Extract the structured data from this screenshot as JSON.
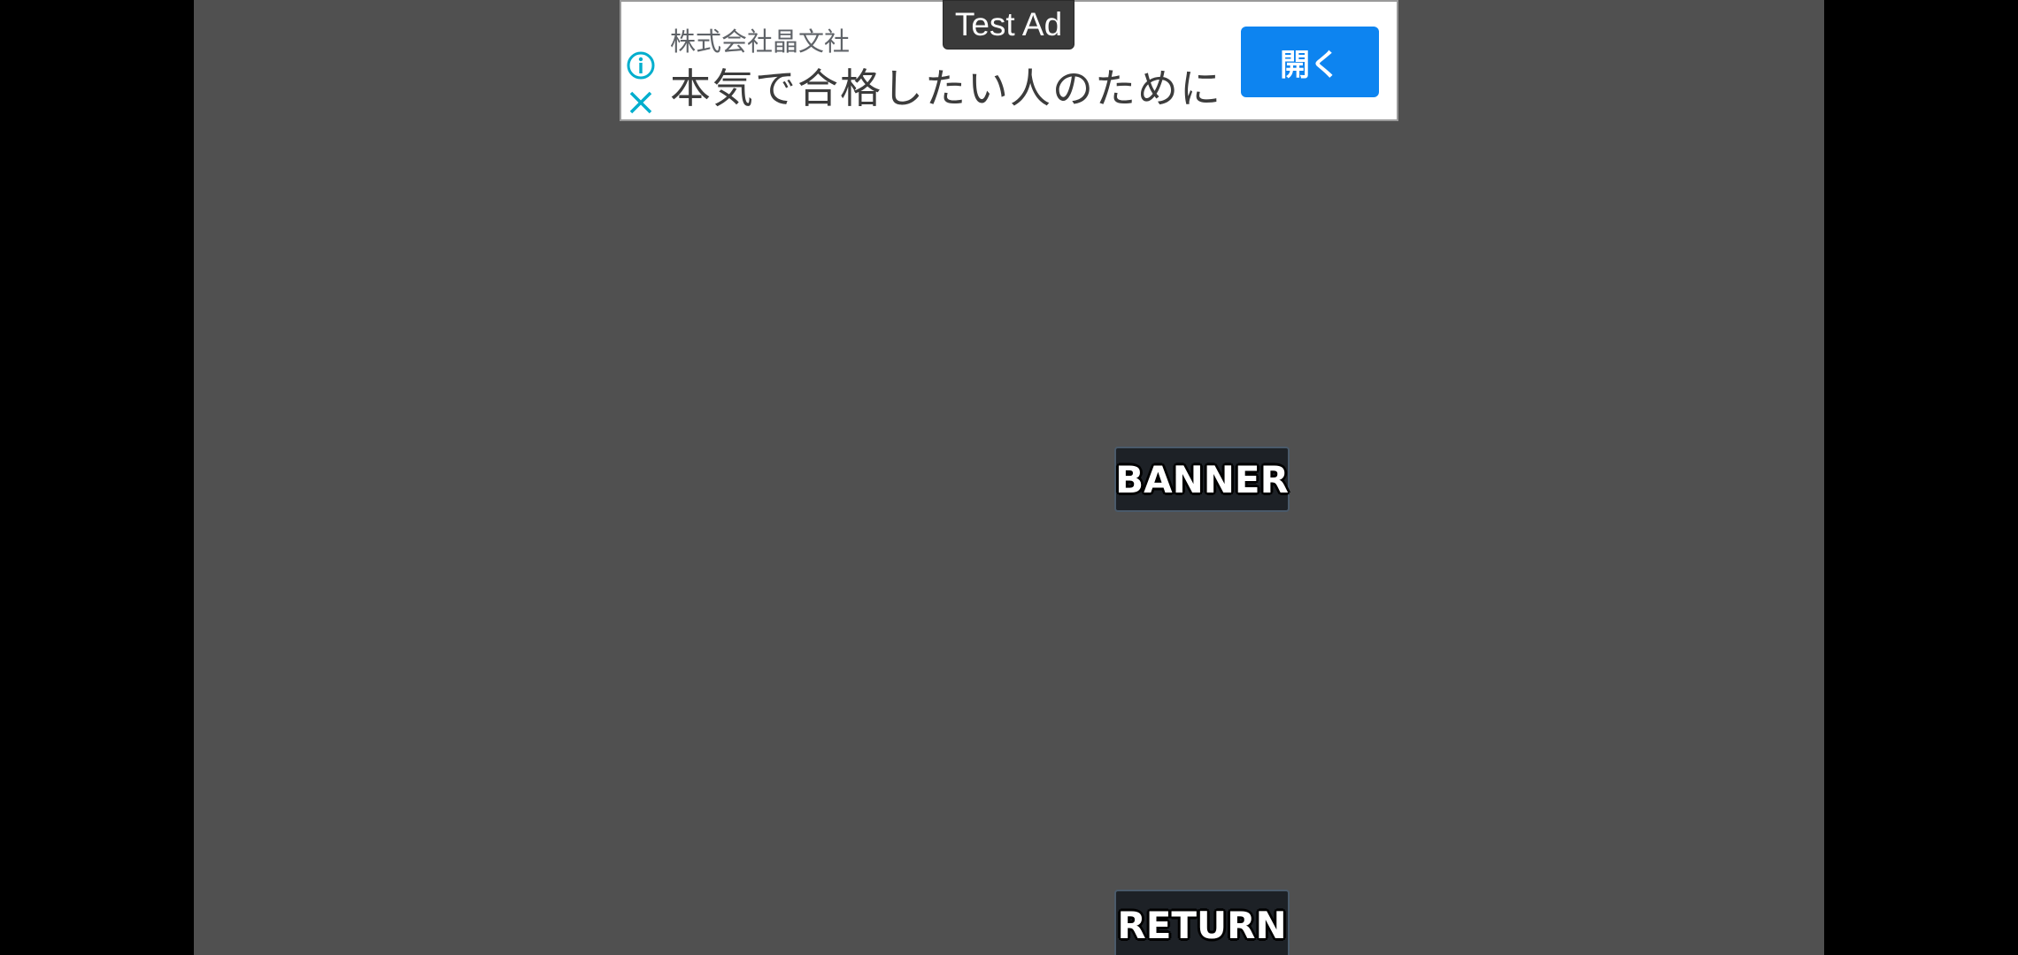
{
  "ad": {
    "test_label": "Test Ad",
    "advertiser": "株式会社晶文社",
    "headline": "本気で合格したい人のために",
    "cta_label": "開く",
    "icons": [
      "info-icon",
      "close-icon"
    ],
    "colors": {
      "cta_background": "#0d84f0",
      "icon_color": "#00aecd"
    }
  },
  "game": {
    "background": "#505050",
    "buttons": {
      "banner_label": "BANNER",
      "return_label": "RETURN"
    }
  }
}
